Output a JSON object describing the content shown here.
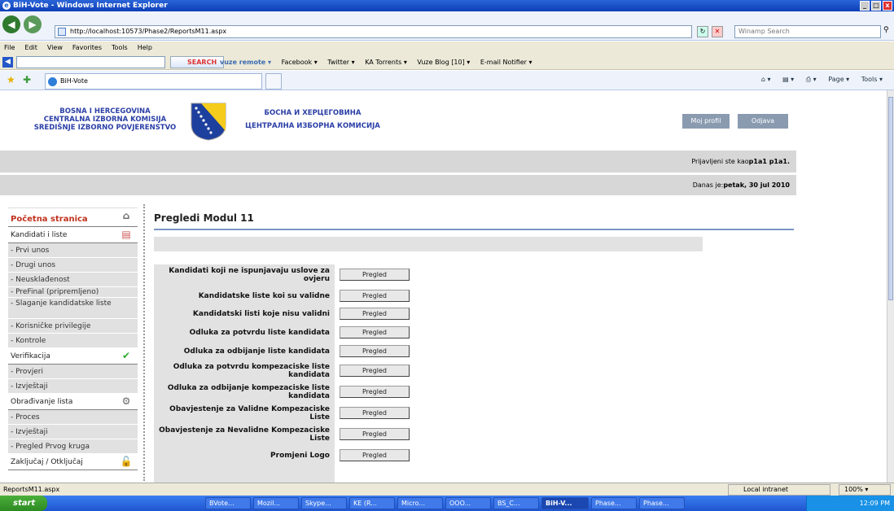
{
  "window": {
    "title": "BiH-Vote - Windows Internet Explorer",
    "controls": [
      "minimize",
      "maximize",
      "close"
    ]
  },
  "address_bar": {
    "url": "http://localhost:10573/Phase2/ReportsM11.aspx",
    "search_placeholder": "Winamp Search"
  },
  "menu": [
    "File",
    "Edit",
    "View",
    "Favorites",
    "Tools",
    "Help"
  ],
  "toolbar": {
    "search_label": "SEARCH",
    "links": [
      "vuze remote ▾",
      "Facebook ▾",
      "Twitter ▾",
      "KA Torrents ▾",
      "Vuze Blog [10] ▾",
      "E-mail Notifier ▾"
    ]
  },
  "favorites_bar": {
    "tab_label": "BiH-Vote",
    "tools": [
      "Page ▾",
      "Tools ▾"
    ]
  },
  "header": {
    "org_latin": [
      "BOSNA I HERCEGOVINA",
      "CENTRALNA IZBORNA KOMISIJA",
      "SREDIŠNJE IZBORNO POVJERENSTVO"
    ],
    "org_cyrillic": [
      "БОСНА И ХЕРЦЕГОВИНА",
      "ЦЕНТРАЛНА ИЗБОРНА КОМИСИЈА"
    ],
    "profile_button": "Moj profil",
    "logout_button": "Odjava"
  },
  "user_info": {
    "logged_prefix": "Prijavljeni ste kao",
    "logged_user": "p1a1 p1a1.",
    "date_prefix": "Danas je:",
    "date_value": "petak, 30 jul 2010"
  },
  "sidebar": {
    "home": "Početna stranica",
    "sections": [
      {
        "title": "Kandidati i liste",
        "icon": "list-icon",
        "items": [
          "- Prvi unos",
          "- Drugi unos",
          "- Neusklađenost",
          "- PreFinal (pripremljeno)",
          "- Slaganje kandidatske liste",
          "- Korisničke privilegije",
          "- Kontrole"
        ]
      },
      {
        "title": "Verifikacija",
        "icon": "check-icon",
        "items": [
          "- Provjeri",
          "- Izvještaji"
        ]
      },
      {
        "title": "Obrađivanje lista",
        "icon": "gear-icon",
        "items": [
          "- Proces",
          "- Izvještaji",
          "- Pregled Prvog kruga"
        ]
      },
      {
        "title": "Zaključaj / Otključaj",
        "icon": "lock-icon",
        "items": []
      }
    ]
  },
  "main": {
    "title": "Pregledi Modul 11",
    "button_label": "Pregled",
    "reports": [
      "Kandidati koji ne ispunjavaju uslove za ovjeru",
      "Kandidatske liste koi su validne",
      "Kandidatski listi koje nisu validni",
      "Odluka za potvrdu liste kandidata",
      "Odluka za odbijanje liste kandidata",
      "Odluka za potvrdu kompezaciske liste kandidata",
      "Odluka za odbijanje kompezaciske liste kandidata",
      "Obavjestenje za Validne Kompezaciske Liste",
      "Obavjestenje za Nevalidne Kompezaciske Liste",
      "Promjeni Logo"
    ]
  },
  "status_bar": {
    "text": "ReportsM11.aspx",
    "zone": "Local intranet",
    "zoom": "100%"
  },
  "taskbar": {
    "start": "start",
    "items": [
      "BVote...",
      "Mozil...",
      "Skype...",
      "KE (R...",
      "Micro...",
      "OOO...",
      "BS_C...",
      "BiH-V...",
      "Phase...",
      "Phase..."
    ],
    "active_index": 7,
    "clock": "12:09 PM"
  },
  "colors": {
    "title_blue": "#0d3fb8",
    "org_text": "#2b3fa6",
    "home_red": "#c0311d",
    "header_button": "#8a9bb0",
    "rule_blue": "#7a95c3"
  }
}
